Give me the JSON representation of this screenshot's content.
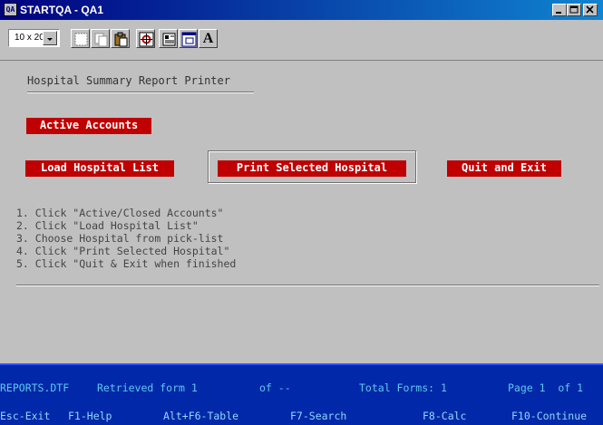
{
  "window": {
    "title": "STARTQA - QA1",
    "icon_label": "QA"
  },
  "toolbar": {
    "font_size_value": "10 x 20",
    "font_button_label": "A"
  },
  "form": {
    "title": "Hospital Summary Report Printer",
    "buttons": {
      "active_accounts": "Active Accounts",
      "load_hospital_list": "Load Hospital List",
      "print_selected_hospital": "Print Selected Hospital",
      "quit_and_exit": "Quit and Exit"
    },
    "instructions": [
      "1. Click \"Active/Closed Accounts\"",
      "2. Click \"Load Hospital List\"",
      "3. Choose Hospital from pick-list",
      "4. Click \"Print Selected Hospital\"",
      "5. Click \"Quit & Exit when finished"
    ]
  },
  "status": {
    "file": "REPORTS.DTF",
    "retrieved": "Retrieved form 1",
    "of": "of --",
    "total_forms": "Total Forms: 1",
    "page": "Page 1  of 1"
  },
  "function_keys": [
    "Esc-Exit",
    "F1-Help",
    "Alt+F6-Table",
    "F7-Search",
    "F8-Calc",
    "F10-Continue"
  ],
  "colors": {
    "button_red": "#c00000",
    "status_blue": "#0028a8",
    "status_text": "#5ec8f0"
  }
}
